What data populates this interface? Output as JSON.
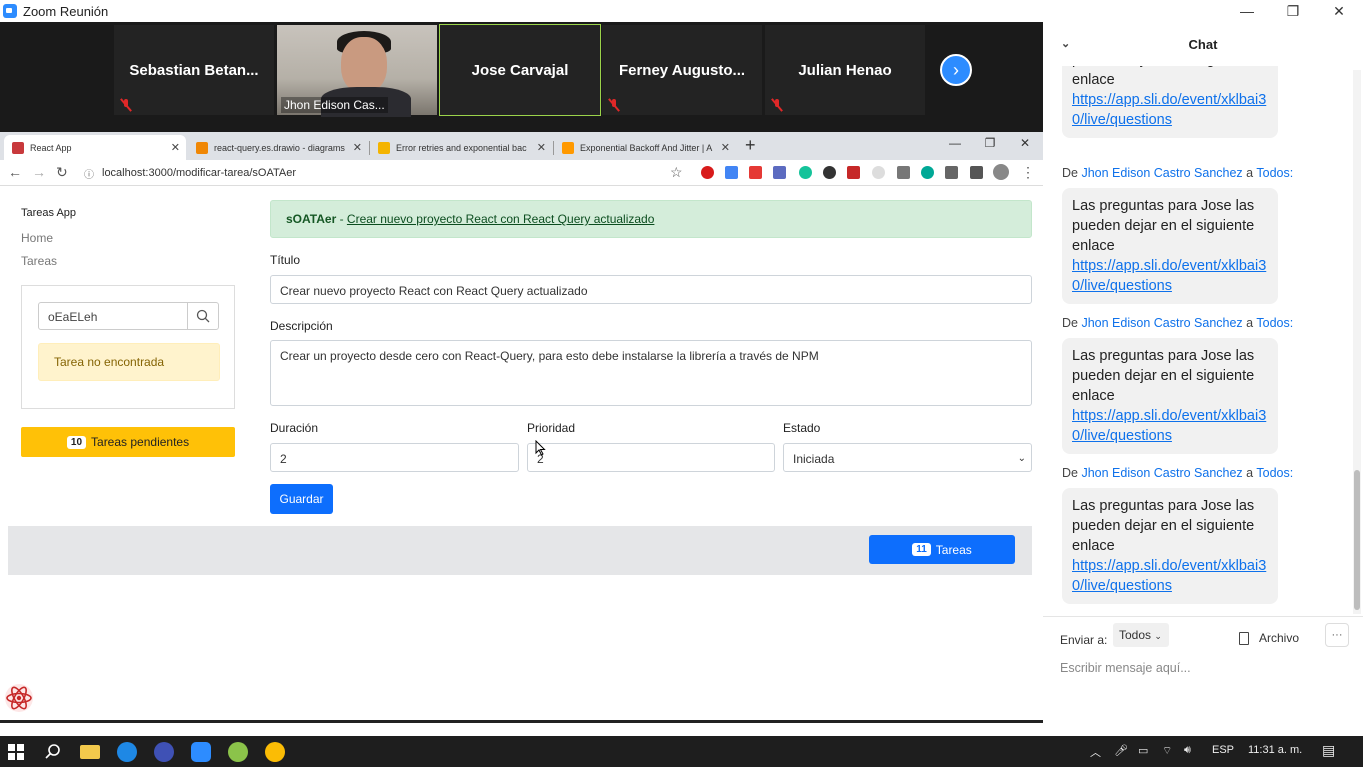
{
  "zoom": {
    "title": "Zoom Reunión",
    "participants": [
      {
        "name": "Sebastian  Betan..."
      },
      {
        "name": "Jhon Edison Cas..."
      },
      {
        "name": "Jose Carvajal"
      },
      {
        "name": "Ferney  Augusto..."
      },
      {
        "name": "Julian Henao"
      }
    ]
  },
  "browser": {
    "tabs": [
      {
        "label": "React App"
      },
      {
        "label": "react-query.es.drawio - diagrams"
      },
      {
        "label": "Error retries and exponential bac"
      },
      {
        "label": "Exponential Backoff And Jitter | A"
      }
    ],
    "url": "localhost:3000/modificar-tarea/sOATAer"
  },
  "app": {
    "brand": "Tareas App",
    "nav": [
      "Home",
      "Tareas"
    ],
    "search_value": "oEaELeh",
    "not_found": "Tarea no encontrada",
    "pending_count": "10",
    "pending_label": "Tareas pendientes",
    "alert_id": "sOATAer",
    "alert_sep": " - ",
    "alert_link": "Crear nuevo proyecto React con React Query actualizado",
    "titulo_label": "Título",
    "titulo_value": "Crear nuevo proyecto React con React Query actualizado",
    "descripcion_label": "Descripción",
    "descripcion_value": "Crear un proyecto desde cero con React-Query, para esto debe instalarse la librería a través de NPM",
    "duracion_label": "Duración",
    "duracion_value": "2",
    "prioridad_label": "Prioridad",
    "prioridad_value": "2",
    "estado_label": "Estado",
    "estado_value": "Iniciada",
    "save_label": "Guardar",
    "footer_count": "11",
    "footer_label": "Tareas"
  },
  "chat": {
    "title": "Chat",
    "messages": [
      {
        "sender": "Jhon Edison Castro Sanchez",
        "to": "Todos:",
        "text": "Las preguntas para Jose las pueden dejar en el siguiente enlace",
        "link": "https://app.sli.do/event/xklbai30/live/questions"
      },
      {
        "sender": "Jhon Edison Castro Sanchez",
        "to": "Todos:",
        "text": "Las preguntas para Jose las pueden dejar en el siguiente enlace",
        "link": "https://app.sli.do/event/xklbai30/live/questions"
      },
      {
        "sender": "Jhon Edison Castro Sanchez",
        "to": "Todos:",
        "text": "Las preguntas para Jose las pueden dejar en el siguiente enlace",
        "link": "https://app.sli.do/event/xklbai30/live/questions"
      },
      {
        "sender": "Jhon Edison Castro Sanchez",
        "to": "Todos:",
        "text": "Las preguntas para Jose las pueden dejar en el siguiente enlace",
        "link": "https://app.sli.do/event/xklbai30/live/questions"
      }
    ],
    "top_partial_text": "pueden dejar en el siguiente enlace",
    "top_partial_link": "https://app.sli.do/event/xklbai30/live/questions",
    "from_word": "De",
    "to_word": "a",
    "send_to_label": "Enviar a:",
    "send_to_value": "Todos",
    "file_label": "Archivo",
    "compose_placeholder": "Escribir mensaje aquí..."
  },
  "taskbar": {
    "lang": "ESP",
    "time": "11:31 a. m."
  },
  "colors": {
    "zoom_blue": "#2d8cff",
    "primary": "#0d6efd",
    "warning": "#ffc107",
    "success_bg": "#d4edda"
  }
}
